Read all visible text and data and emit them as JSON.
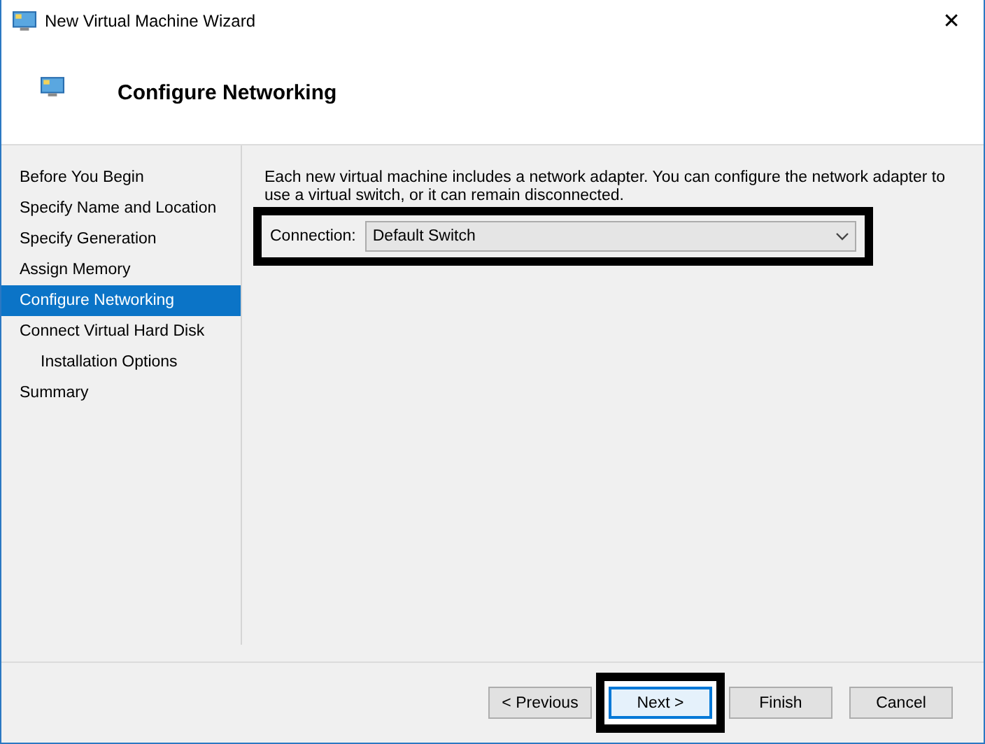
{
  "window": {
    "title": "New Virtual Machine Wizard",
    "close": "✕"
  },
  "header": {
    "title": "Configure Networking"
  },
  "sidebar": {
    "items": [
      {
        "label": "Before You Begin",
        "selected": false
      },
      {
        "label": "Specify Name and Location",
        "selected": false
      },
      {
        "label": "Specify Generation",
        "selected": false
      },
      {
        "label": "Assign Memory",
        "selected": false
      },
      {
        "label": "Configure Networking",
        "selected": true
      },
      {
        "label": "Connect Virtual Hard Disk",
        "selected": false,
        "children": [
          {
            "label": "Installation Options",
            "selected": false
          }
        ]
      },
      {
        "label": "Summary",
        "selected": false
      }
    ]
  },
  "content": {
    "description": "Each new virtual machine includes a network adapter. You can configure the network adapter to use a virtual switch, or it can remain disconnected.",
    "connection": {
      "label": "Connection:",
      "value": "Default Switch",
      "highlighted": true
    }
  },
  "buttons": [
    {
      "label": "< Previous",
      "default": false,
      "highlighted": false
    },
    {
      "label": "Next >",
      "default": true,
      "highlighted": true
    },
    {
      "label": "Finish",
      "default": false,
      "highlighted": false
    },
    {
      "label": "Cancel",
      "default": false,
      "highlighted": false
    }
  ]
}
